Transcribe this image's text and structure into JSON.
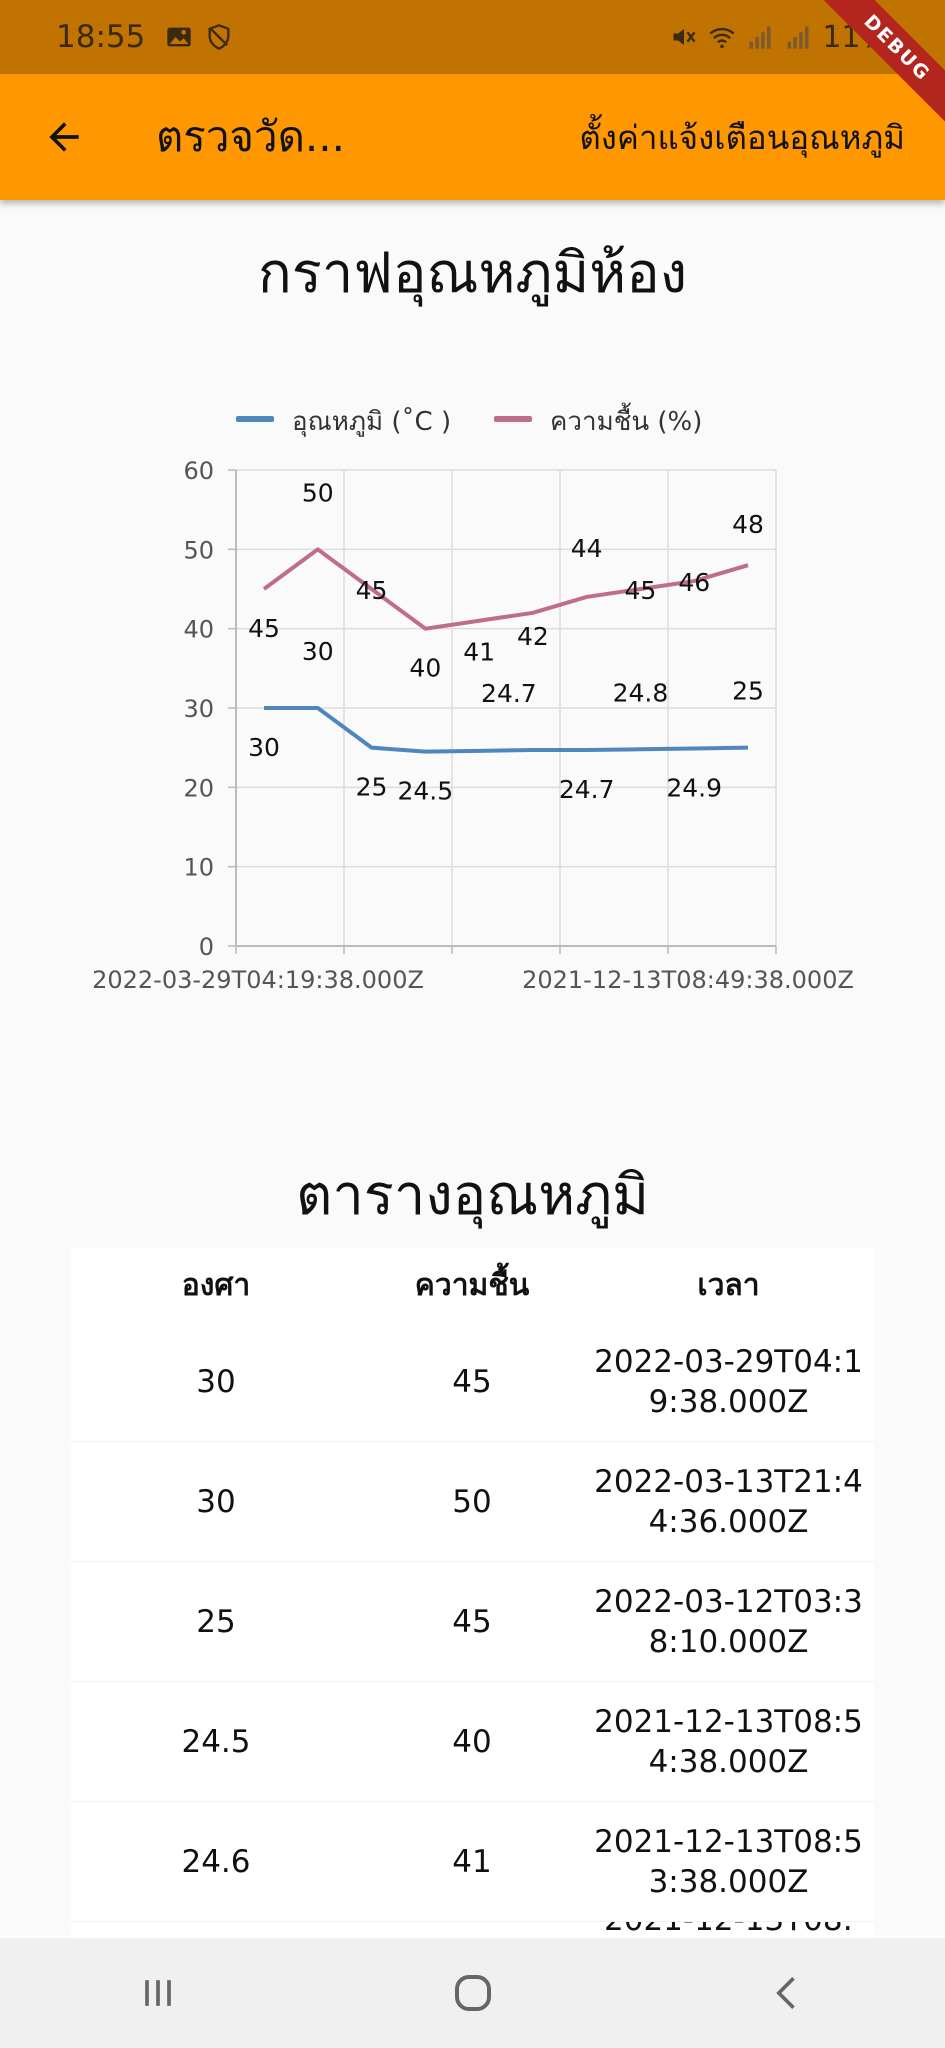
{
  "status": {
    "time": "18:55",
    "battery": "11%"
  },
  "debug_label": "DEBUG",
  "appbar": {
    "title": "ตรวจวัด...",
    "action": "ตั้งค่าแจ้งเตือนอุณหภูมิ"
  },
  "chart_title": "กราฟอุณหภูมิห้อง",
  "chart_data": {
    "type": "line",
    "x": [
      "2022-03-29T04:19:38.000Z",
      "2022-03-13T21:44:36.000Z",
      "2022-03-12T03:38:10.000Z",
      "2021-12-13T08:54:38.000Z",
      "2021-12-13T08:53:38.000Z",
      "",
      "",
      "",
      "",
      "2021-12-13T08:49:38.000Z"
    ],
    "x_tick_labels": [
      "2022-03-29T04:19:38.000Z",
      "2021-12-13T08:49:38.000Z"
    ],
    "series": [
      {
        "name": "อุณหภูมิ (˚C )",
        "color": "#4e87bd",
        "values": [
          30,
          30,
          25,
          24.5,
          24.6,
          24.7,
          24.7,
          24.8,
          24.9,
          25
        ]
      },
      {
        "name": "ความชื้น (%)",
        "color": "#c06e85",
        "values": [
          45,
          50,
          45,
          40,
          41,
          42,
          44,
          45,
          46,
          48
        ]
      }
    ],
    "point_labels": {
      "temp": [
        "30",
        "30",
        "25",
        "24.5",
        "",
        "24.7",
        "24.7",
        "24.8",
        "24.9",
        "25"
      ],
      "hum": [
        "45",
        "50",
        "45",
        "40",
        "41",
        "42",
        "44",
        "45",
        "46",
        "48"
      ]
    },
    "ylim": [
      0,
      60
    ],
    "y_ticks": [
      0,
      10,
      20,
      30,
      40,
      50,
      60
    ],
    "grid": true,
    "legend": "top"
  },
  "table_title": "ตารางอุณหภูมิ",
  "table": {
    "headers": [
      "องศา",
      "ความชื้น",
      "เวลา"
    ],
    "rows": [
      [
        "30",
        "45",
        "2022-03-29T04:19:38.000Z"
      ],
      [
        "30",
        "50",
        "2022-03-13T21:44:36.000Z"
      ],
      [
        "25",
        "45",
        "2022-03-12T03:38:10.000Z"
      ],
      [
        "24.5",
        "40",
        "2021-12-13T08:54:38.000Z"
      ],
      [
        "24.6",
        "41",
        "2021-12-13T08:53:38.000Z"
      ],
      [
        "",
        "",
        "2021-12-13T08:"
      ]
    ]
  },
  "nav": {
    "recents": "recents-icon",
    "home": "home-icon",
    "back": "back-icon"
  }
}
